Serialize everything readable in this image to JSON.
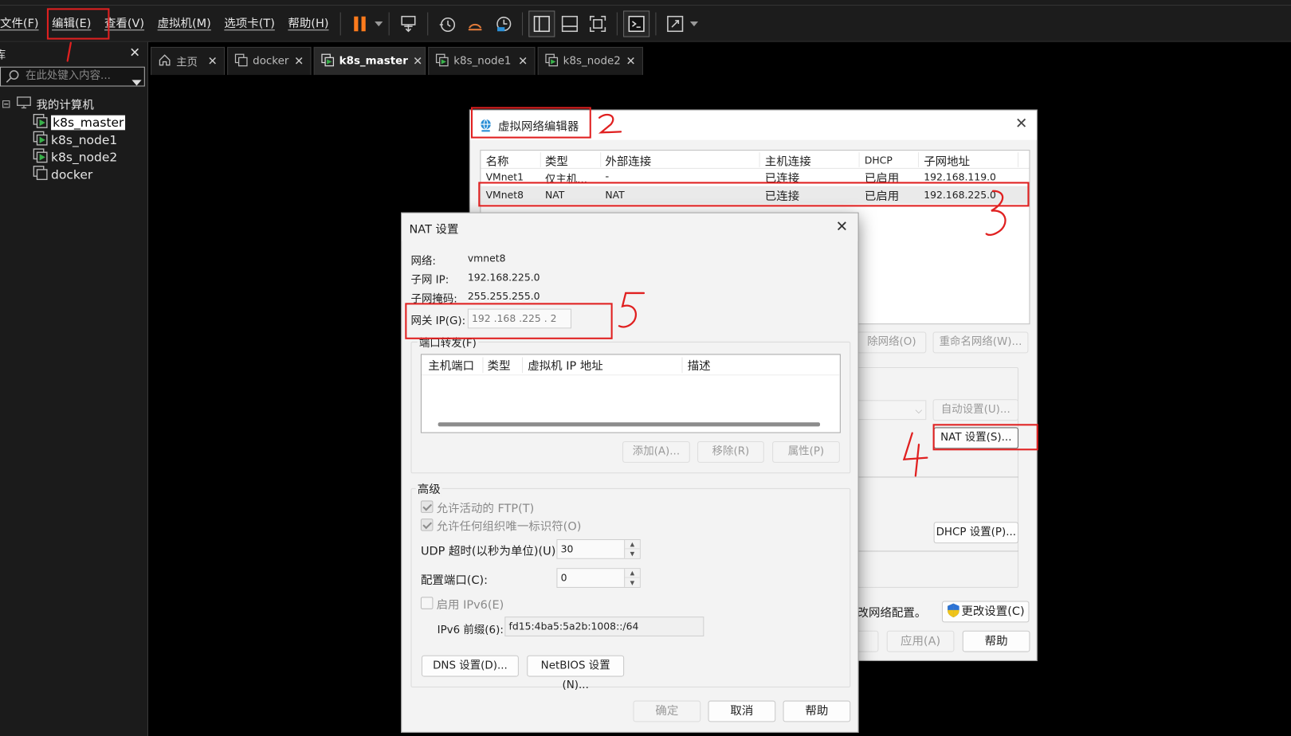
{
  "menubar": {
    "items": [
      "文件(F)",
      "编辑(E)",
      "查看(V)",
      "虚拟机(M)",
      "选项卡(T)",
      "帮助(H)"
    ]
  },
  "toolbar": {
    "icons": [
      "pause-icon",
      "send-keys-icon",
      "snapshot-icon",
      "revert-snapshot-icon",
      "manage-snapshots-icon",
      "sidebar-toggle-icon",
      "thumbnail-bar-icon",
      "fullscreen-icon",
      "console-icon",
      "stretch-icon"
    ]
  },
  "sidebar": {
    "title": "库",
    "search_placeholder": "在此处键入内容...",
    "tree": {
      "root": "我的计算机",
      "items": [
        {
          "label": "k8s_master",
          "selected": true
        },
        {
          "label": "k8s_node1"
        },
        {
          "label": "k8s_node2"
        },
        {
          "label": "docker"
        }
      ]
    }
  },
  "tabs": [
    {
      "label": "主页"
    },
    {
      "label": "docker"
    },
    {
      "label": "k8s_master",
      "active": true
    },
    {
      "label": "k8s_node1"
    },
    {
      "label": "k8s_node2"
    }
  ],
  "vne": {
    "title": "虚拟网络编辑器",
    "columns": [
      "名称",
      "类型",
      "外部连接",
      "主机连接",
      "DHCP",
      "子网地址"
    ],
    "rows": [
      {
        "name": "VMnet1",
        "type": "仅主机...",
        "ext": "-",
        "host": "已连接",
        "dhcp": "已启用",
        "subnet": "192.168.119.0"
      },
      {
        "name": "VMnet8",
        "type": "NAT",
        "ext": "NAT",
        "host": "已连接",
        "dhcp": "已启用",
        "subnet": "192.168.225.0"
      }
    ],
    "remove_network": "除网络(O)",
    "rename_network": "重命名网络(W)...",
    "auto_settings": "自动设置(U)...",
    "nat_settings": "NAT 设置(S)...",
    "dhcp_settings": "DHCP 设置(P)...",
    "admin_note": "改网络配置。",
    "change_settings": "更改设置(C)",
    "apply": "应用(A)",
    "help": "帮助"
  },
  "nat": {
    "title": "NAT 设置",
    "network_label": "网络:",
    "network_value": "vmnet8",
    "subnet_ip_label": "子网 IP:",
    "subnet_ip_value": "192.168.225.0",
    "subnet_mask_label": "子网掩码:",
    "subnet_mask_value": "255.255.255.0",
    "gateway_label": "网关 IP(G):",
    "gateway_value": "192 .168 .225 .  2",
    "port_forwarding": {
      "title": "端口转发(F)",
      "columns": [
        "主机端口",
        "类型",
        "虚拟机 IP 地址",
        "描述"
      ],
      "add": "添加(A)...",
      "remove": "移除(R)",
      "properties": "属性(P)"
    },
    "advanced": {
      "title": "高级",
      "allow_ftp": "允许活动的 FTP(T)",
      "allow_oui": "允许任何组织唯一标识符(O)",
      "udp_timeout_label": "UDP 超时(以秒为单位)(U):",
      "udp_timeout_value": "30",
      "config_port_label": "配置端口(C):",
      "config_port_value": "0",
      "enable_ipv6": "启用 IPv6(E)",
      "ipv6_prefix_label": "IPv6 前缀(6):",
      "ipv6_prefix_value": "fd15:4ba5:5a2b:1008::/64",
      "dns": "DNS 设置(D)...",
      "netbios": "NetBIOS 设置(N)..."
    },
    "ok": "确定",
    "cancel": "取消",
    "help": "帮助"
  },
  "annotations": {
    "n1": "1",
    "n2": "2",
    "n3": "3",
    "n4": "4",
    "n5": "5"
  },
  "colors": {
    "annotation_red": "#e02020",
    "vmware_orange": "#ff7b1c",
    "accent_blue": "#2b8fd6"
  }
}
